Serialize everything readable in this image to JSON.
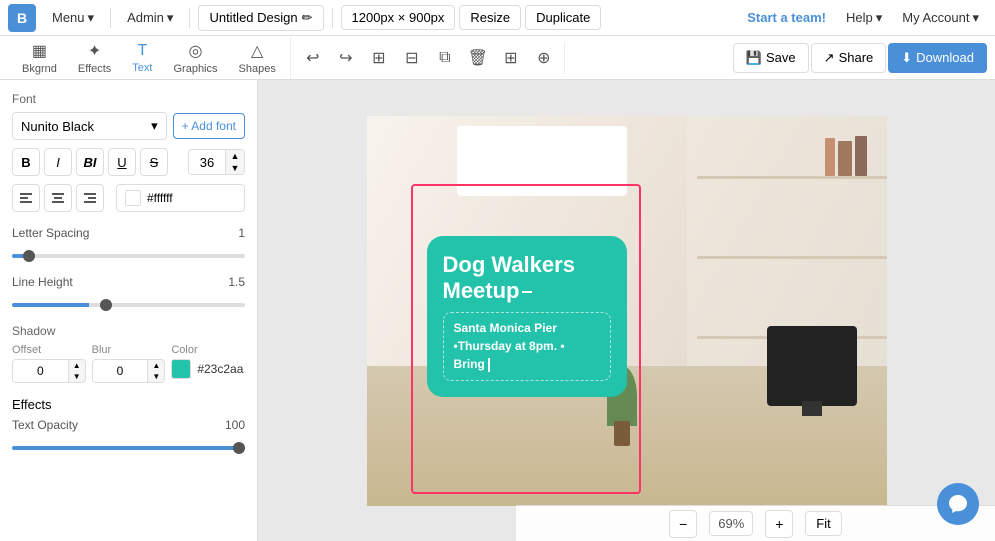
{
  "topnav": {
    "logo": "B",
    "menu": "Menu",
    "admin": "Admin",
    "design_name": "Untitled Design",
    "pencil_icon": "✏",
    "canvas_size": "1200px × 900px",
    "resize": "Resize",
    "duplicate": "Duplicate",
    "start_team": "Start a team!",
    "help": "Help",
    "account": "My Account"
  },
  "toolbar": {
    "tabs": [
      {
        "id": "bkgrnd",
        "label": "Bkgrnd",
        "icon": "▦"
      },
      {
        "id": "effects",
        "label": "Effects",
        "icon": "✦"
      },
      {
        "id": "text",
        "label": "Text",
        "icon": "T"
      },
      {
        "id": "graphics",
        "label": "Graphics",
        "icon": "◎"
      },
      {
        "id": "shapes",
        "label": "Shapes",
        "icon": "△"
      }
    ],
    "actions": {
      "undo": "↩",
      "redo": "↪",
      "copy_style": "⊞",
      "paste_style": "⊟",
      "copy": "⧉",
      "delete": "🗑",
      "grid": "⊞",
      "magnet": "⊕"
    },
    "save": "Save",
    "share": "Share",
    "download": "Download"
  },
  "panel": {
    "font_section_label": "Font",
    "font_name": "Nunito Black",
    "add_font": "+ Add font",
    "bold": "B",
    "italic": "I",
    "bold_italic": "BI",
    "underline": "U",
    "strikethrough": "S",
    "font_size": "36",
    "align_left": "≡",
    "align_center": "≡",
    "align_right": "≡",
    "color_hex": "#ffffff",
    "letter_spacing_label": "Letter Spacing",
    "letter_spacing_value": "1",
    "line_height_label": "Line Height",
    "line_height_value": "1.5",
    "shadow_label": "Shadow",
    "offset_label": "Offset",
    "offset_value": "0",
    "blur_label": "Blur",
    "blur_value": "0",
    "color_label": "Color",
    "shadow_color": "#23c2aa",
    "effects_label": "Effects",
    "text_opacity_label": "Text Opacity",
    "text_opacity_value": "100"
  },
  "canvas": {
    "card_title_line1": "Dog Walkers",
    "card_title_line2": "Meetup",
    "card_subtitle": "Santa Monica Pier",
    "card_line2": "•Thursday at 8pm. •",
    "card_line3": "Bring",
    "zoom_level": "69%",
    "fit_label": "Fit"
  },
  "colors": {
    "teal": "#23c2aa",
    "pink_selection": "#ff3366",
    "blue_accent": "#4a90d9"
  }
}
